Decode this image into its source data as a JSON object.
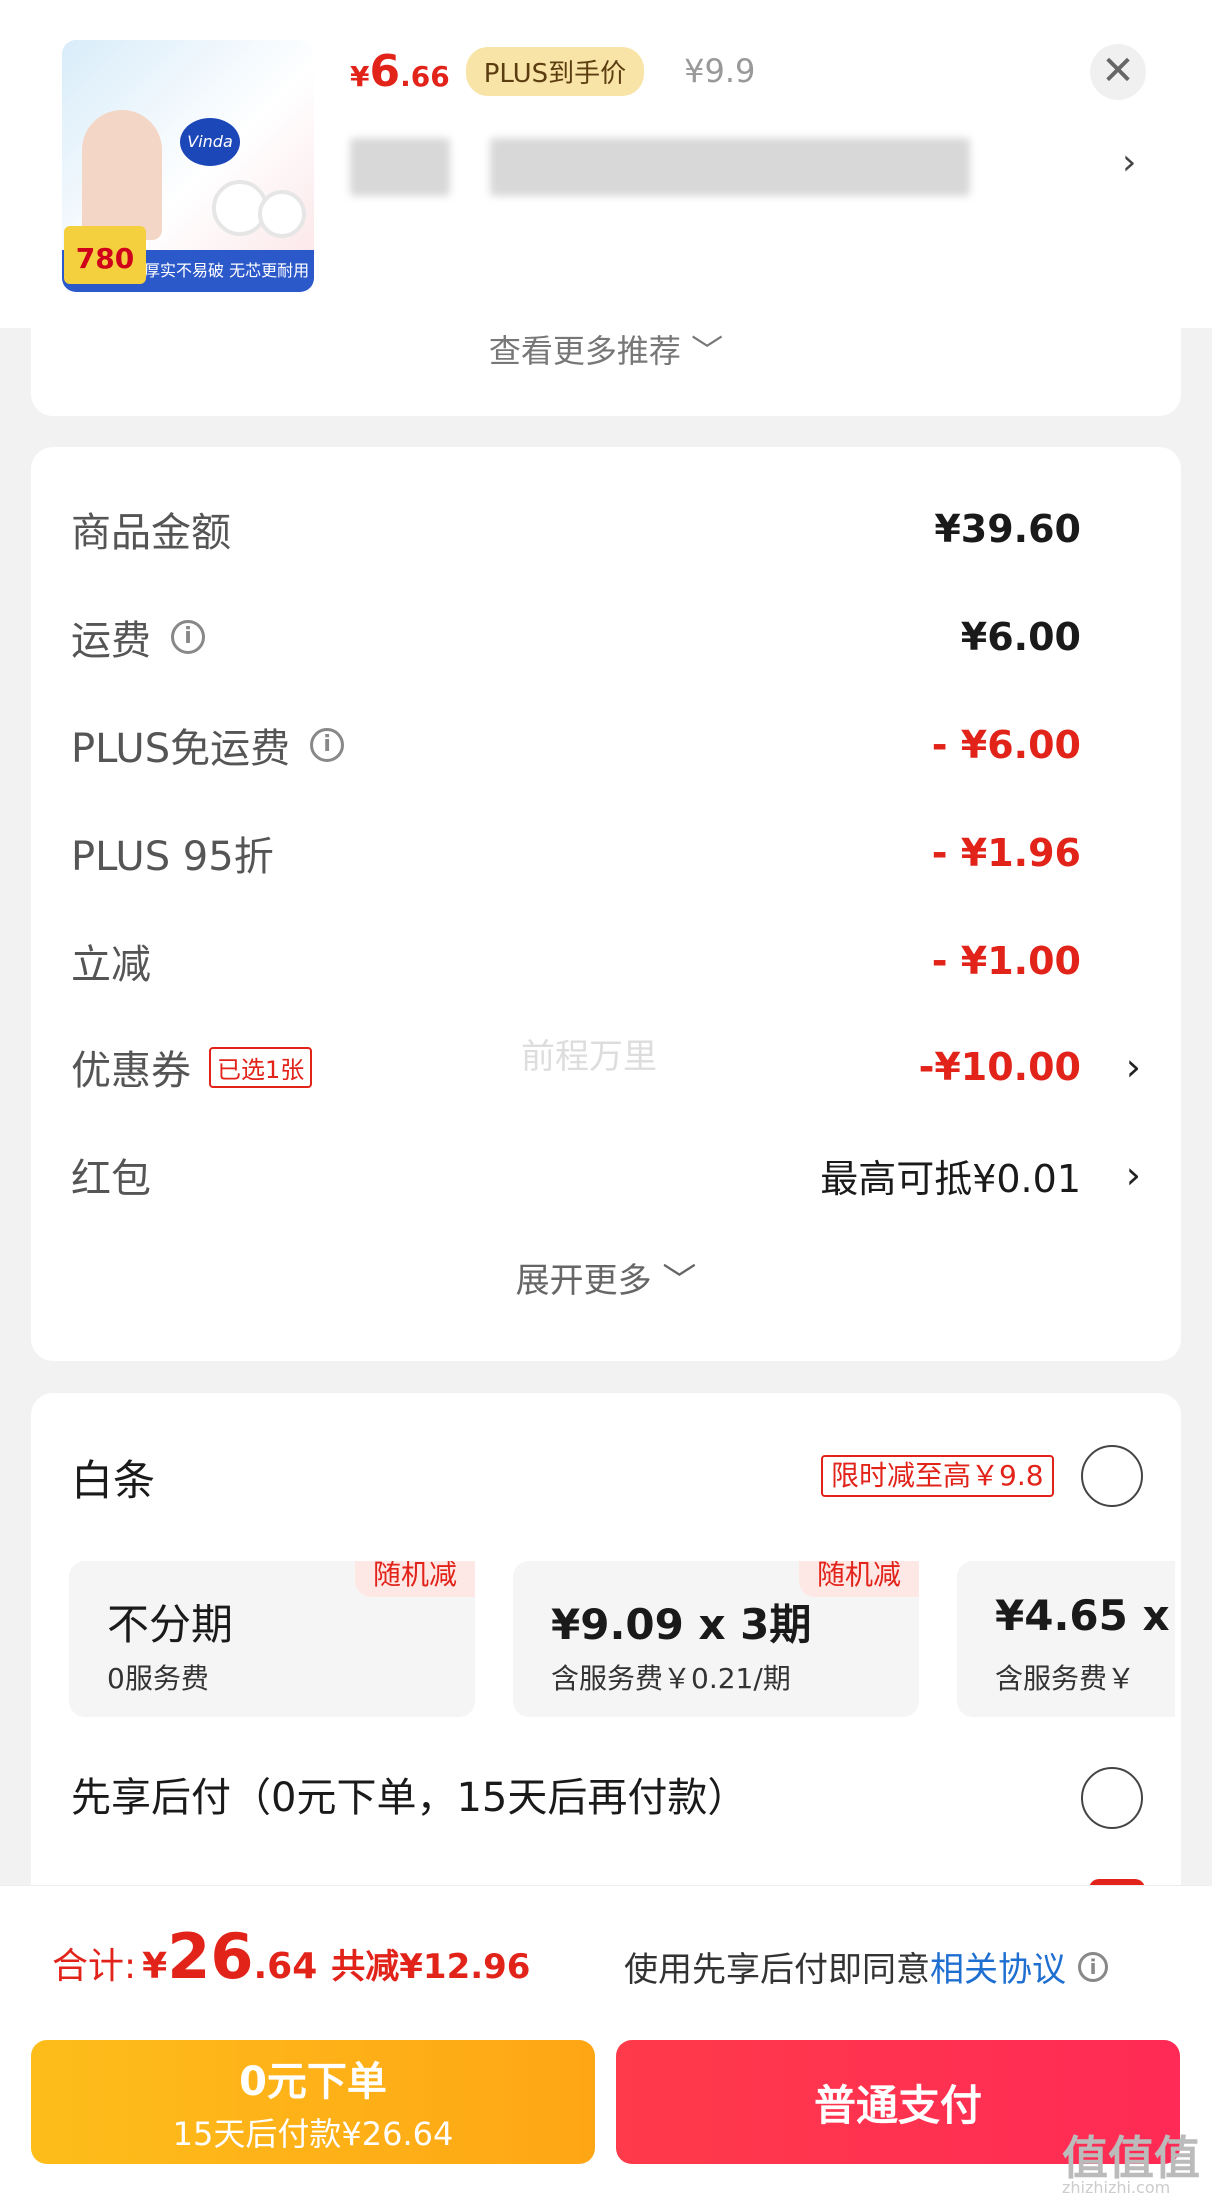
{
  "product": {
    "price_symbol": "¥",
    "price_int": "6",
    "price_dec": ".66",
    "plus_tag": "PLUS到手价",
    "price_old": "¥9.9",
    "close_glyph": "✕",
    "thumb_brand": "Vinda",
    "thumb_weight": "780克",
    "thumb_banner": "厚实不易破 无芯更耐用"
  },
  "recommend": {
    "label": "查看更多推荐 ﹀"
  },
  "fees": {
    "rows": [
      {
        "label": "商品金额",
        "value": "¥39.60",
        "tone": "black",
        "info": false
      },
      {
        "label": "运费",
        "value": "¥6.00",
        "tone": "black",
        "info": true
      },
      {
        "label": "PLUS免运费",
        "value": "- ¥6.00",
        "tone": "red",
        "info": true
      },
      {
        "label": "PLUS 95折",
        "value": "- ¥1.96",
        "tone": "red",
        "info": false
      },
      {
        "label": "立减",
        "value": "- ¥1.00",
        "tone": "red",
        "info": false
      }
    ],
    "coupon": {
      "label": "优惠券",
      "tag": "已选1张",
      "value": "-¥10.00"
    },
    "redpacket": {
      "label": "红包",
      "value": "最高可抵¥0.01"
    },
    "expand_more": "展开更多 ﹀",
    "watermark": "前程万里"
  },
  "payment": {
    "baitiao_title": "白条",
    "promo_tag": "限时减至高￥9.8",
    "plans": [
      {
        "main": "不分期",
        "sub": "0服务费",
        "badge": "随机减"
      },
      {
        "main": "¥9.09 x 3期",
        "sub": "含服务费￥0.21/期",
        "badge": "随机减"
      },
      {
        "main": "¥4.65 x",
        "sub": "含服务费￥",
        "badge": ""
      }
    ],
    "later_label": "先享后付（0元下单，15天后再付款）"
  },
  "bottom": {
    "total_label": "合计:",
    "total_yen": "¥",
    "total_int": "26",
    "total_dec": ".64",
    "total_saved": "共减¥12.96",
    "agree_text": "使用先享后付即同意",
    "agree_link": "相关协议",
    "btn_later_l1": "0元下单",
    "btn_later_l2": "15天后付款¥26.64",
    "btn_pay": "普通支付"
  },
  "corner": {
    "logo": "值值值",
    "url": "zhizhizhi.com"
  },
  "icons": {
    "chevron": "›",
    "info": "i"
  },
  "colors": {
    "accent_red": "#e2231a",
    "plus_gold": "#f8e4a7",
    "link_blue": "#1f6fd1",
    "later_yellow": "#fdbd1a"
  }
}
